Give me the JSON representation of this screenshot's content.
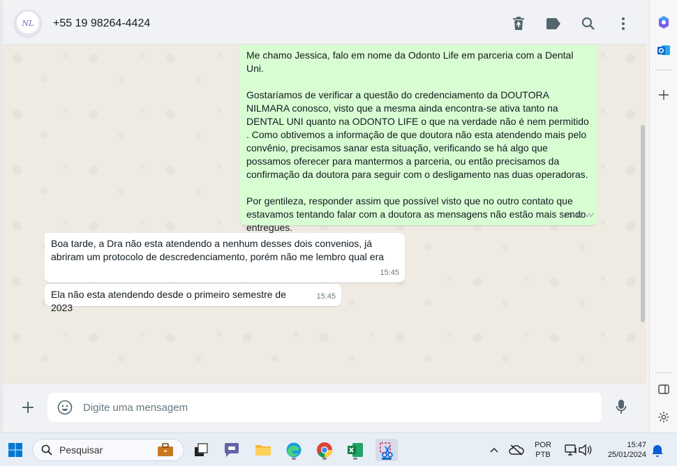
{
  "header": {
    "contact_name": "+55 19 98264-4424",
    "avatar_text": "NL"
  },
  "messages": [
    {
      "direction": "outgoing",
      "text": "Me chamo Jessica, falo em nome da Odonto Life em parceria com a Dental Uni.\n\nGostaríamos de verificar a questão do credenciamento da DOUTORA NILMARA conosco, visto que a mesma ainda encontra-se ativa tanto na DENTAL UNI quanto na ODONTO LIFE o que na verdade não é nem permitido . Como obtivemos a informação de que doutora não esta atendendo mais pelo convênio, precisamos sanar esta situação, verificando se há algo que possamos oferecer para mantermos a parceria, ou então precisamos da confirmação da doutora para seguir com o desligamento nas duas operadoras.\n\nPor gentileza, responder assim que possível visto que no outro contato que estavamos tentando falar com a doutora as mensagens não estão mais sendo entregues.",
      "time": "15:42"
    },
    {
      "direction": "incoming",
      "text": "Boa tarde, a Dra não esta atendendo a nenhum desses dois convenios, já abriram um protocolo de descredenciamento, porém não me lembro qual era",
      "time": "15:45"
    },
    {
      "direction": "incoming",
      "text": "Ela não esta atendendo desde o primeiro semestre de 2023",
      "time": "15:45"
    }
  ],
  "composer": {
    "placeholder": "Digite uma mensagem"
  },
  "taskbar": {
    "search_label": "Pesquisar",
    "lang_1": "POR",
    "lang_2": "PTB",
    "clock_time": "15:47",
    "clock_date": "25/01/2024"
  },
  "colors": {
    "outgoing_bubble": "#d9fdd3",
    "incoming_bubble": "#ffffff",
    "chat_background": "#efeae2"
  }
}
